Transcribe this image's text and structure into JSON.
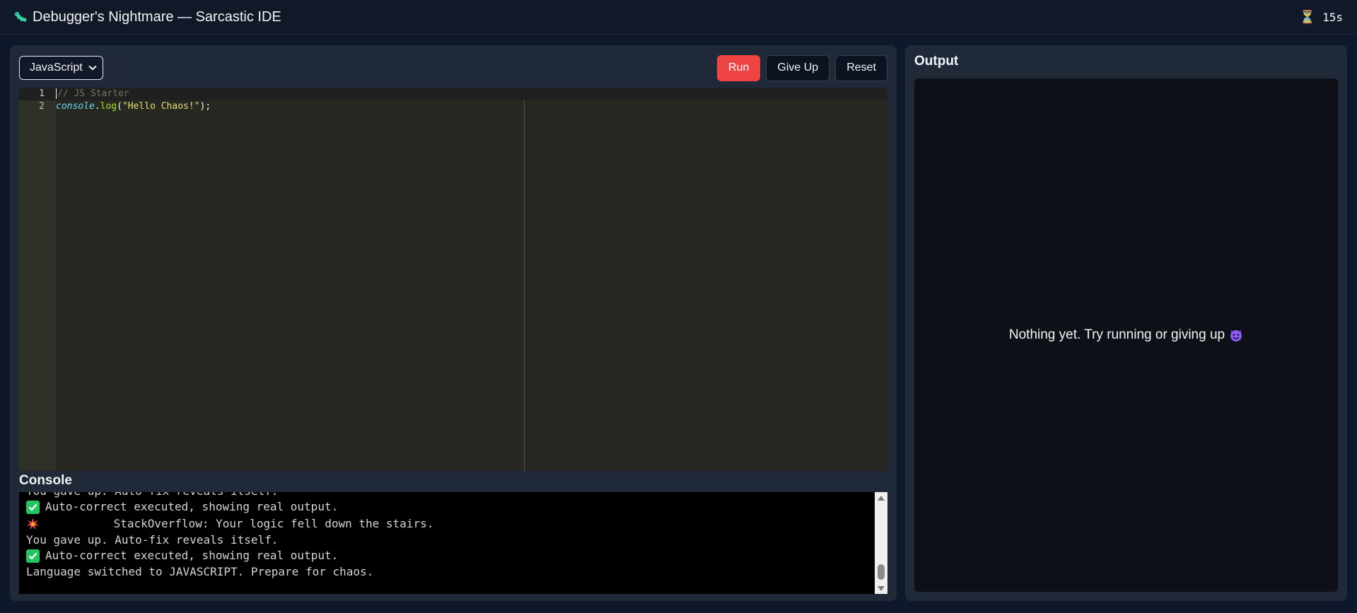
{
  "header": {
    "title": "Debugger's Nightmare — Sarcastic IDE",
    "timer": "15s"
  },
  "toolbar": {
    "language": "JavaScript",
    "run_label": "Run",
    "giveup_label": "Give Up",
    "reset_label": "Reset"
  },
  "editor": {
    "line_numbers": [
      "1",
      "2"
    ],
    "line1_comment": "// JS Starter",
    "line2_obj": "console",
    "line2_dot": ".",
    "line2_fn": "log",
    "line2_open": "(",
    "line2_str": "\"Hello Chaos!\"",
    "line2_close": ");"
  },
  "console": {
    "title": "Console",
    "lines": [
      "You gave up. Auto-fix reveals itself.",
      "Auto-correct executed, showing real output.",
      "StackOverflow: Your logic fell down the stairs.",
      "You gave up. Auto-fix reveals itself.",
      "Auto-correct executed, showing real output.",
      "Language switched to JAVASCRIPT. Prepare for chaos."
    ]
  },
  "output": {
    "title": "Output",
    "message": "Nothing yet. Try running or giving up"
  },
  "colors": {
    "run_button": "#ef4444",
    "check": "#22c55e",
    "devil": "#8b5cf6"
  }
}
